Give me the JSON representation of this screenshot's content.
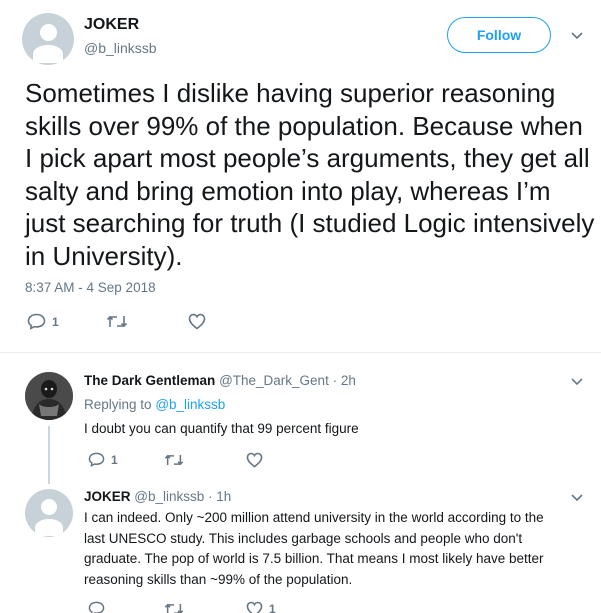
{
  "main_tweet": {
    "name": "JOKER",
    "handle": "@b_linkssb",
    "follow_label": "Follow",
    "text": "Sometimes I dislike having superior reasoning skills over 99% of the population. Because when I pick apart most people’s arguments, they get all salty and bring emotion into play, whereas I’m just searching for truth (I studied Logic intensively in University).",
    "timestamp": "8:37 AM - 4 Sep 2018",
    "reply_count": "1",
    "retweet_count": "",
    "like_count": ""
  },
  "reply1": {
    "name": "The Dark Gentleman",
    "handle": "@The_Dark_Gent",
    "time": "· 2h",
    "replying_prefix": "Replying to",
    "replying_to": "@b_linkssb",
    "text": "I doubt you can quantify that 99 percent figure",
    "reply_count": "1"
  },
  "reply2": {
    "name": "JOKER",
    "handle": "@b_linkssb",
    "time": "· 1h",
    "text_lines": [
      "I can indeed. Only ~200 million attend university in the world according to the",
      "last UNESCO study. This includes garbage schools and people who don't",
      "graduate. The pop of world is 7.5 billion. That means I most likely have better",
      "reasoning skills than ~99% of the population."
    ],
    "like_count": "1"
  },
  "icons": {
    "reply": "reply-icon",
    "retweet": "retweet-icon",
    "like": "heart-icon",
    "more": "chevron-down-icon",
    "avatar": "default-avatar-icon"
  },
  "colors": {
    "accent": "#1da1f2",
    "muted": "#657786",
    "text": "#14171a",
    "divider": "#e6ecf0",
    "avatar_bg": "#c7d1d8"
  }
}
